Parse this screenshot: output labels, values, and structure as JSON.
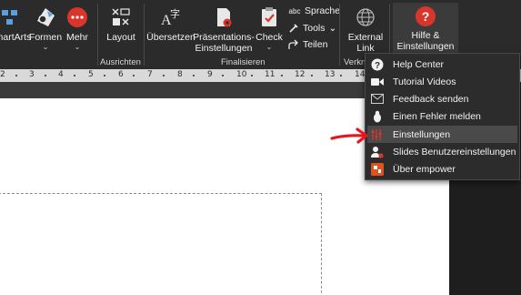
{
  "ribbon": {
    "smartarts": "SmartArts",
    "formen": "Formen",
    "mehr": "Mehr",
    "layout": "Layout",
    "ausrichten": "Ausrichten",
    "uebersetzen": "Übersetzen",
    "praesentationen_line1": "Präsentations-",
    "praesentationen_line2": "Einstellungen",
    "check": "Check",
    "sprache": "Sprache",
    "tools": "Tools",
    "teilen": "Teilen",
    "finalisieren": "Finalisieren",
    "external_line1": "External",
    "external_line2": "Link",
    "verkn": "Verkn",
    "hilfe_line1": "Hilfe &",
    "hilfe_line2": "Einstellungen",
    "abc": "abc",
    "chevron": "⌄"
  },
  "ruler": {
    "numbers": [
      "2",
      "3",
      "4",
      "5",
      "6",
      "7",
      "8",
      "9",
      "10",
      "11",
      "12",
      "13",
      "14"
    ]
  },
  "menu": {
    "items": [
      {
        "label": "Help Center",
        "icon": "help-circle-icon"
      },
      {
        "label": "Tutorial Videos",
        "icon": "video-camera-icon"
      },
      {
        "label": "Feedback senden",
        "icon": "envelope-icon"
      },
      {
        "label": "Einen Fehler melden",
        "icon": "bug-icon"
      },
      {
        "label": "Einstellungen",
        "icon": "sliders-icon"
      },
      {
        "label": "Slides Benutzereinstellungen",
        "icon": "user-settings-icon"
      },
      {
        "label": "Über empower",
        "icon": "empower-logo-icon"
      }
    ],
    "active_index": 4
  },
  "colors": {
    "accent_red": "#d9362b",
    "highlight": "#4a4a4a",
    "ribbon_bg": "#2b2b2b",
    "annotation_arrow": "#e8141e"
  }
}
